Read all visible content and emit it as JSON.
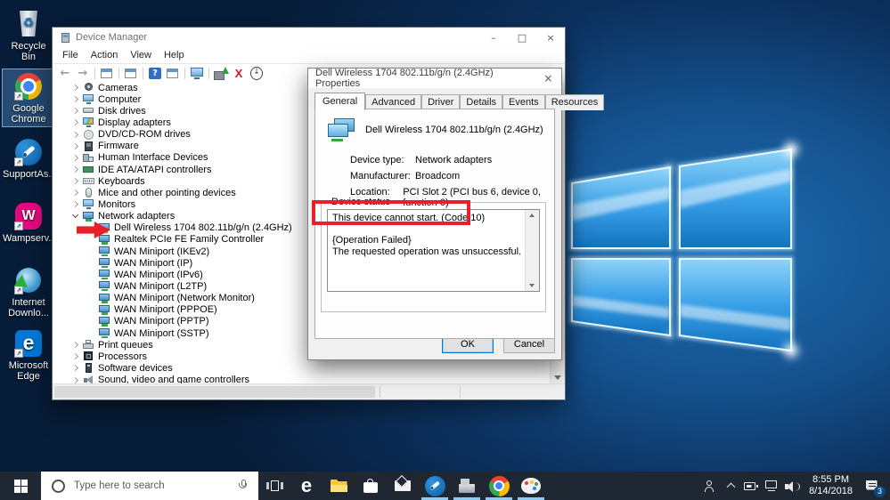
{
  "desktop": {
    "icons": [
      {
        "label": "Recycle Bin",
        "icon": "recycle-bin-icon",
        "shortcut": false,
        "selected": false
      },
      {
        "label": "Google Chrome",
        "icon": "chrome-icon",
        "shortcut": true,
        "selected": true
      },
      {
        "label": "SupportAs...",
        "icon": "supportassist-icon",
        "shortcut": true,
        "selected": false
      },
      {
        "label": "Wampserv...",
        "icon": "wampserver-icon",
        "shortcut": true,
        "selected": false
      },
      {
        "label": "Internet Downlo...",
        "icon": "idm-icon",
        "shortcut": true,
        "selected": false
      },
      {
        "label": "Microsoft Edge",
        "icon": "edge-icon",
        "shortcut": true,
        "selected": false
      }
    ]
  },
  "device_manager": {
    "title": "Device Manager",
    "caption": {
      "minimize": "–",
      "maximize": "□",
      "close": "×"
    },
    "menu": [
      "File",
      "Action",
      "View",
      "Help"
    ],
    "toolbar": [
      "back-icon",
      "forward-icon",
      "|",
      "show-hide-console-tree-icon",
      "|",
      "export-list-icon",
      "|",
      "help-icon",
      "properties-icon",
      "|",
      "scan-hardware-changes-icon",
      "|",
      "update-driver-icon",
      "uninstall-device-icon",
      "disable-device-icon"
    ],
    "tree": [
      {
        "label": "Cameras",
        "icon": "camera-icon",
        "state": "collapsed",
        "level": 1
      },
      {
        "label": "Computer",
        "icon": "computer-icon",
        "state": "collapsed",
        "level": 1
      },
      {
        "label": "Disk drives",
        "icon": "disk-drive-icon",
        "state": "collapsed",
        "level": 1
      },
      {
        "label": "Display adapters",
        "icon": "display-adapter-icon",
        "state": "collapsed",
        "level": 1
      },
      {
        "label": "DVD/CD-ROM drives",
        "icon": "dvd-drive-icon",
        "state": "collapsed",
        "level": 1
      },
      {
        "label": "Firmware",
        "icon": "firmware-icon",
        "state": "collapsed",
        "level": 1
      },
      {
        "label": "Human Interface Devices",
        "icon": "hid-icon",
        "state": "collapsed",
        "level": 1
      },
      {
        "label": "IDE ATA/ATAPI controllers",
        "icon": "ide-controller-icon",
        "state": "collapsed",
        "level": 1
      },
      {
        "label": "Keyboards",
        "icon": "keyboard-icon",
        "state": "collapsed",
        "level": 1
      },
      {
        "label": "Mice and other pointing devices",
        "icon": "mouse-icon",
        "state": "collapsed",
        "level": 1
      },
      {
        "label": "Monitors",
        "icon": "monitor-icon",
        "state": "collapsed",
        "level": 1
      },
      {
        "label": "Network adapters",
        "icon": "network-adapter-icon",
        "state": "expanded",
        "level": 1
      },
      {
        "label": "Dell Wireless 1704 802.11b/g/n (2.4GHz)",
        "icon": "network-adapter-icon",
        "level": 2,
        "warning": true,
        "annotated": true
      },
      {
        "label": "Realtek PCIe FE Family Controller",
        "icon": "network-adapter-icon",
        "level": 2
      },
      {
        "label": "WAN Miniport (IKEv2)",
        "icon": "network-adapter-icon",
        "level": 2
      },
      {
        "label": "WAN Miniport (IP)",
        "icon": "network-adapter-icon",
        "level": 2
      },
      {
        "label": "WAN Miniport (IPv6)",
        "icon": "network-adapter-icon",
        "level": 2
      },
      {
        "label": "WAN Miniport (L2TP)",
        "icon": "network-adapter-icon",
        "level": 2
      },
      {
        "label": "WAN Miniport (Network Monitor)",
        "icon": "network-adapter-icon",
        "level": 2
      },
      {
        "label": "WAN Miniport (PPPOE)",
        "icon": "network-adapter-icon",
        "level": 2
      },
      {
        "label": "WAN Miniport (PPTP)",
        "icon": "network-adapter-icon",
        "level": 2
      },
      {
        "label": "WAN Miniport (SSTP)",
        "icon": "network-adapter-icon",
        "level": 2
      },
      {
        "label": "Print queues",
        "icon": "printer-icon",
        "state": "collapsed",
        "level": 1
      },
      {
        "label": "Processors",
        "icon": "processor-icon",
        "state": "collapsed",
        "level": 1
      },
      {
        "label": "Software devices",
        "icon": "software-device-icon",
        "state": "collapsed",
        "level": 1
      },
      {
        "label": "Sound, video and game controllers",
        "icon": "sound-icon",
        "state": "collapsed",
        "level": 1
      }
    ]
  },
  "properties_dialog": {
    "title": "Dell Wireless 1704 802.11b/g/n (2.4GHz) Properties",
    "close": "×",
    "tabs": [
      "General",
      "Advanced",
      "Driver",
      "Details",
      "Events",
      "Resources"
    ],
    "active_tab": "General",
    "device_name": "Dell Wireless 1704 802.11b/g/n (2.4GHz)",
    "fields": [
      {
        "label": "Device type:",
        "value": "Network adapters"
      },
      {
        "label": "Manufacturer:",
        "value": "Broadcom"
      },
      {
        "label": "Location:",
        "value": "PCI Slot 2 (PCI bus 6, device 0, function 0)"
      }
    ],
    "device_status_label": "Device status",
    "status_lines": [
      "This device cannot start. (Code 10)",
      "",
      "{Operation Failed}",
      "The requested operation was unsuccessful."
    ],
    "buttons": {
      "ok": "OK",
      "cancel": "Cancel"
    }
  },
  "annotations": {
    "color": "#e8202a",
    "highlight_box_target": "This device cannot start. (Code 10)",
    "arrow_target": "Dell Wireless 1704 802.11b/g/n (2.4GHz)"
  },
  "taskbar": {
    "search_placeholder": "Type here to search",
    "app_icons": [
      {
        "name": "task-view-icon",
        "running": false
      },
      {
        "name": "edge-taskbar-icon",
        "running": false
      },
      {
        "name": "file-explorer-icon",
        "running": false
      },
      {
        "name": "store-icon",
        "running": false
      },
      {
        "name": "mail-icon",
        "running": false
      },
      {
        "name": "supportassist-taskbar-icon",
        "running": true
      },
      {
        "name": "device-manager-taskbar-icon",
        "running": true
      },
      {
        "name": "chrome-taskbar-icon",
        "running": true
      },
      {
        "name": "paint-taskbar-icon",
        "running": true
      }
    ],
    "tray": {
      "time": "8:55 PM",
      "date": "8/14/2018",
      "badge": "3"
    }
  }
}
